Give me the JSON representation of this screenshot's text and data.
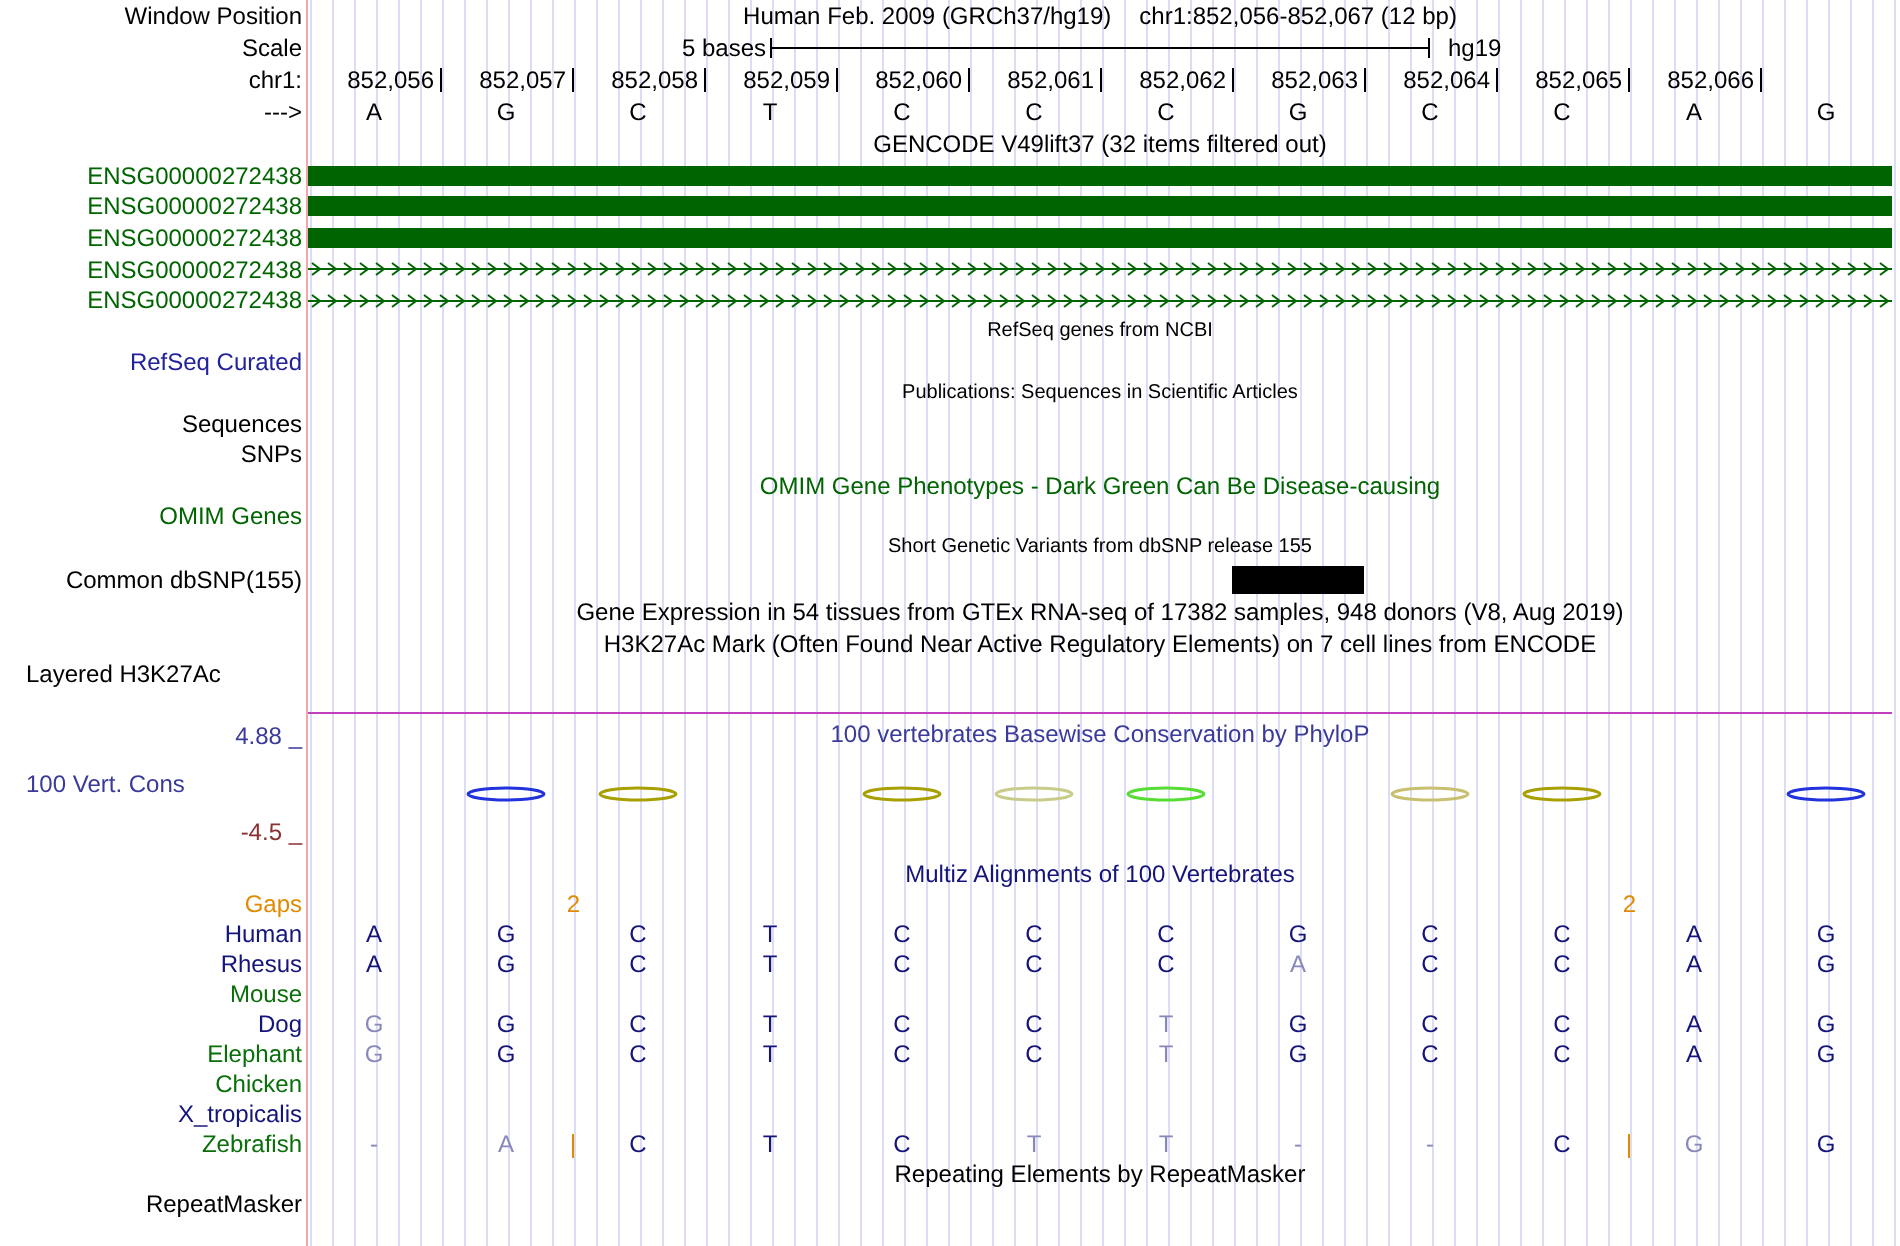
{
  "position": {
    "label": "Window Position",
    "assembly_text": "Human Feb. 2009 (GRCh37/hg19)",
    "range": "chr1:852,056-852,067 (12 bp)"
  },
  "scale": {
    "label": "Scale",
    "span": "5 bases",
    "assembly": "hg19"
  },
  "ruler": {
    "label": "chr1:",
    "positions": [
      "852,056",
      "852,057",
      "852,058",
      "852,059",
      "852,060",
      "852,061",
      "852,062",
      "852,063",
      "852,064",
      "852,065",
      "852,066"
    ]
  },
  "sequence": {
    "label": "--->",
    "bases": [
      "A",
      "G",
      "C",
      "T",
      "C",
      "C",
      "C",
      "G",
      "C",
      "C",
      "A",
      "G"
    ]
  },
  "gencode": {
    "title": "GENCODE V49lift37 (32 items filtered out)",
    "transcripts": [
      {
        "name": "ENSG00000272438",
        "kind": "exon"
      },
      {
        "name": "ENSG00000272438",
        "kind": "exon"
      },
      {
        "name": "ENSG00000272438",
        "kind": "exon"
      },
      {
        "name": "ENSG00000272438",
        "kind": "intron"
      },
      {
        "name": "ENSG00000272438",
        "kind": "intron"
      }
    ]
  },
  "tracks": [
    {
      "kind": "caption",
      "text": "RefSeq genes from NCBI"
    },
    {
      "kind": "label",
      "text": "RefSeq Curated",
      "color": "#22229a"
    },
    {
      "kind": "caption",
      "text": "Publications: Sequences in Scientific Articles"
    },
    {
      "kind": "label",
      "text": "Sequences",
      "color": "#000000"
    },
    {
      "kind": "label",
      "text": "SNPs",
      "color": "#000000"
    },
    {
      "kind": "title",
      "text": "OMIM Gene Phenotypes - Dark Green Can Be Disease-causing",
      "color": "#006400"
    },
    {
      "kind": "label",
      "text": "OMIM Genes",
      "color": "#006400"
    },
    {
      "kind": "caption",
      "text": "Short Genetic Variants from dbSNP release 155"
    },
    {
      "kind": "variants",
      "text": "Common dbSNP(155)",
      "color": "#000000",
      "cells": [
        {
          "variant": false
        },
        {
          "variant": false
        },
        {
          "variant": false
        },
        {
          "variant": false
        },
        {
          "variant": false
        },
        {
          "variant": false
        },
        {
          "variant": false
        },
        {
          "variant": true
        },
        {
          "variant": false
        },
        {
          "variant": false
        },
        {
          "variant": false
        },
        {
          "variant": false
        }
      ]
    },
    {
      "kind": "title",
      "text": "Gene Expression in 54 tissues from GTEx RNA-seq of 17382 samples, 948 donors (V8, Aug 2019)",
      "color": "#000000"
    },
    {
      "kind": "title",
      "text": "H3K27Ac Mark (Often Found Near Active Regulatory Elements) on 7 cell lines from ENCODE",
      "color": "#000000"
    },
    {
      "kind": "sidelabel",
      "text": "Layered H3K27Ac",
      "color": "#000000"
    }
  ],
  "conservation": {
    "title": "100 vertebrates Basewise Conservation by PhyloP",
    "label": "100 Vert. Cons",
    "max": "4.88 _",
    "min": "-4.5 _"
  },
  "multiz": {
    "title": "Multiz Alignments of 100 Vertebrates",
    "gaps": {
      "label": "Gaps",
      "cells": [
        {},
        {
          "insertion": "2"
        },
        {},
        {},
        {},
        {},
        {},
        {},
        {},
        {
          "insertion": "2"
        },
        {},
        {}
      ]
    },
    "species": [
      {
        "name": "Human",
        "color": "#14147a",
        "cells": [
          {
            "base": "A",
            "match": true
          },
          {
            "base": "G",
            "match": true
          },
          {
            "base": "C",
            "match": true
          },
          {
            "base": "T",
            "match": true
          },
          {
            "base": "C",
            "match": true
          },
          {
            "base": "C",
            "match": true
          },
          {
            "base": "C",
            "match": true
          },
          {
            "base": "G",
            "match": true
          },
          {
            "base": "C",
            "match": true
          },
          {
            "base": "C",
            "match": true
          },
          {
            "base": "A",
            "match": true
          },
          {
            "base": "G",
            "match": true
          }
        ]
      },
      {
        "name": "Rhesus",
        "color": "#14147a",
        "cells": [
          {
            "base": "A",
            "match": true
          },
          {
            "base": "G",
            "match": true
          },
          {
            "base": "C",
            "match": true
          },
          {
            "base": "T",
            "match": true
          },
          {
            "base": "C",
            "match": true
          },
          {
            "base": "C",
            "match": true
          },
          {
            "base": "C",
            "match": true
          },
          {
            "base": "A",
            "match": false
          },
          {
            "base": "C",
            "match": true
          },
          {
            "base": "C",
            "match": true
          },
          {
            "base": "A",
            "match": true
          },
          {
            "base": "G",
            "match": true
          }
        ]
      },
      {
        "name": "Mouse",
        "color": "#0a6e0a"
      },
      {
        "name": "Dog",
        "color": "#14147a",
        "cells": [
          {
            "base": "G",
            "match": false
          },
          {
            "base": "G",
            "match": true
          },
          {
            "base": "C",
            "match": true
          },
          {
            "base": "T",
            "match": true
          },
          {
            "base": "C",
            "match": true
          },
          {
            "base": "C",
            "match": true
          },
          {
            "base": "T",
            "match": false
          },
          {
            "base": "G",
            "match": true
          },
          {
            "base": "C",
            "match": true
          },
          {
            "base": "C",
            "match": true
          },
          {
            "base": "A",
            "match": true
          },
          {
            "base": "G",
            "match": true
          }
        ]
      },
      {
        "name": "Elephant",
        "color": "#0a6e0a",
        "cells": [
          {
            "base": "G",
            "match": false
          },
          {
            "base": "G",
            "match": true
          },
          {
            "base": "C",
            "match": true
          },
          {
            "base": "T",
            "match": true
          },
          {
            "base": "C",
            "match": true
          },
          {
            "base": "C",
            "match": true
          },
          {
            "base": "T",
            "match": false
          },
          {
            "base": "G",
            "match": true
          },
          {
            "base": "C",
            "match": true
          },
          {
            "base": "C",
            "match": true
          },
          {
            "base": "A",
            "match": true
          },
          {
            "base": "G",
            "match": true
          }
        ]
      },
      {
        "name": "Chicken",
        "color": "#0a6e0a"
      },
      {
        "name": "X_tropicalis",
        "color": "#14147a"
      },
      {
        "name": "Zebrafish",
        "color": "#0a6e0a",
        "cells": [
          {
            "base": "-",
            "match": false
          },
          {
            "base": "A",
            "match": false,
            "insert_mark": true
          },
          {
            "base": "C",
            "match": true
          },
          {
            "base": "T",
            "match": true
          },
          {
            "base": "C",
            "match": true
          },
          {
            "base": "T",
            "match": false
          },
          {
            "base": "T",
            "match": false
          },
          {
            "base": "-",
            "match": false
          },
          {
            "base": "-",
            "match": false
          },
          {
            "base": "C",
            "match": true,
            "insert_mark": true
          },
          {
            "base": "G",
            "match": false
          },
          {
            "base": "G",
            "match": true
          }
        ]
      }
    ]
  },
  "repeatmasker": {
    "title": "Repeating Elements by RepeatMasker",
    "label": "RepeatMasker"
  }
}
